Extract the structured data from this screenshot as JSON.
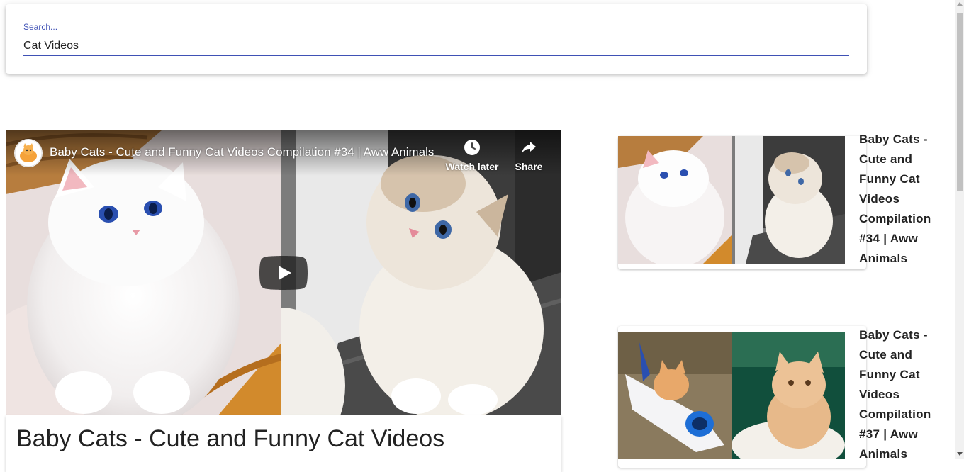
{
  "search": {
    "label": "Search...",
    "value": "Cat Videos"
  },
  "player": {
    "title": "Baby Cats - Cute and Funny Cat Videos Compilation #34 | Aww Animals",
    "watch_later_label": "Watch later",
    "share_label": "Share",
    "icons": {
      "play": "play-icon",
      "watch_later": "clock-icon",
      "share": "share-arrow-icon",
      "channel": "channel-avatar"
    }
  },
  "main": {
    "title": "Baby Cats - Cute and Funny Cat Videos"
  },
  "related": [
    {
      "title": "Baby Cats - Cute and Funny Cat Videos Compilation #34 | Aww Animals"
    },
    {
      "title": "Baby Cats - Cute and Funny Cat Videos Compilation #37 | Aww Animals"
    }
  ],
  "colors": {
    "accent": "#3f51b5",
    "youtube_play": "#212121"
  }
}
